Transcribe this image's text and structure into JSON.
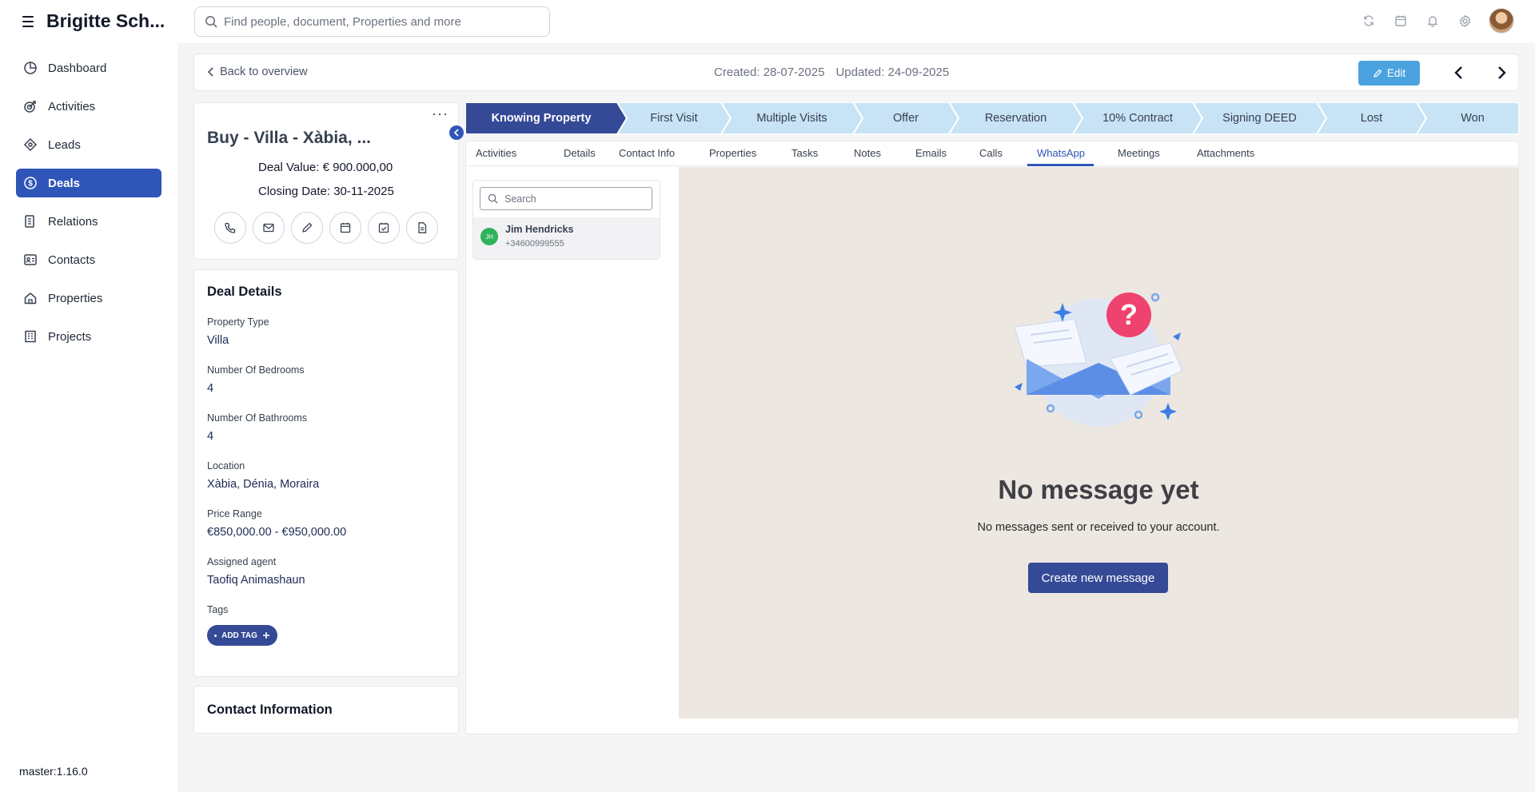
{
  "header": {
    "brand": "Brigitte Sch...",
    "search_placeholder": "Find people, document, Properties and more",
    "icons": [
      "sync-icon",
      "calendar-icon",
      "bell-icon",
      "gear-icon",
      "avatar"
    ]
  },
  "sidebar": {
    "items": [
      {
        "label": "Dashboard",
        "icon": "dashboard-icon"
      },
      {
        "label": "Activities",
        "icon": "activities-icon"
      },
      {
        "label": "Leads",
        "icon": "leads-icon"
      },
      {
        "label": "Deals",
        "icon": "deals-icon",
        "active": true
      },
      {
        "label": "Relations",
        "icon": "relations-icon"
      },
      {
        "label": "Contacts",
        "icon": "contacts-icon"
      },
      {
        "label": "Properties",
        "icon": "properties-icon"
      },
      {
        "label": "Projects",
        "icon": "projects-icon"
      }
    ],
    "version": "master:1.16.0"
  },
  "overview": {
    "back_label": "Back to overview",
    "created": "Created: 28-07-2025",
    "updated": "Updated: 24-09-2025",
    "edit_label": "Edit"
  },
  "deal": {
    "title": "Buy - Villa - Xàbia, ...",
    "value": "Deal Value:  € 900.000,00",
    "closing": "Closing Date: 30-11-2025",
    "actions": [
      "phone-icon",
      "mail-icon",
      "pencil-icon",
      "calendar-icon",
      "calendar-check-icon",
      "document-icon"
    ]
  },
  "details": {
    "title": "Deal Details",
    "fields": [
      {
        "label": "Property Type",
        "value": "Villa"
      },
      {
        "label": "Number Of Bedrooms",
        "value": "4"
      },
      {
        "label": "Number Of Bathrooms",
        "value": "4"
      },
      {
        "label": "Location",
        "value": "Xàbia, Dénia, Moraira"
      },
      {
        "label": "Price Range",
        "value": "€850,000.00 - €950,000.00"
      },
      {
        "label": "Assigned agent",
        "value": "Taofiq Animashaun"
      }
    ],
    "tags_label": "Tags",
    "add_tag_label": "ADD TAG"
  },
  "contact_info": {
    "title": "Contact Information"
  },
  "pipeline": {
    "stages": [
      "Knowing Property",
      "First Visit",
      "Multiple Visits",
      "Offer",
      "Reservation",
      "10% Contract",
      "Signing DEED",
      "Lost",
      "Won"
    ],
    "active_index": 0,
    "colors": {
      "active": "#354a97",
      "inactive": "#c8e3f5"
    }
  },
  "tabs": {
    "items": [
      "Activities",
      "Details",
      "Contact Info",
      "Properties",
      "Tasks",
      "Notes",
      "Emails",
      "Calls",
      "WhatsApp",
      "Meetings",
      "Attachments"
    ],
    "active": "WhatsApp"
  },
  "chats": {
    "search_placeholder": "Search",
    "items": [
      {
        "initials": "JH",
        "name": "Jim Hendricks",
        "phone": "+34600999555"
      }
    ]
  },
  "empty_state": {
    "title": "No message yet",
    "subtitle": "No messages sent or received to your account.",
    "button": "Create new message"
  },
  "colors": {
    "primary": "#2f55b8",
    "dark_button": "#354a97",
    "edit_button": "#4aa3df",
    "message_bg": "#ede7e1",
    "avatar_green": "#2eb35a"
  }
}
